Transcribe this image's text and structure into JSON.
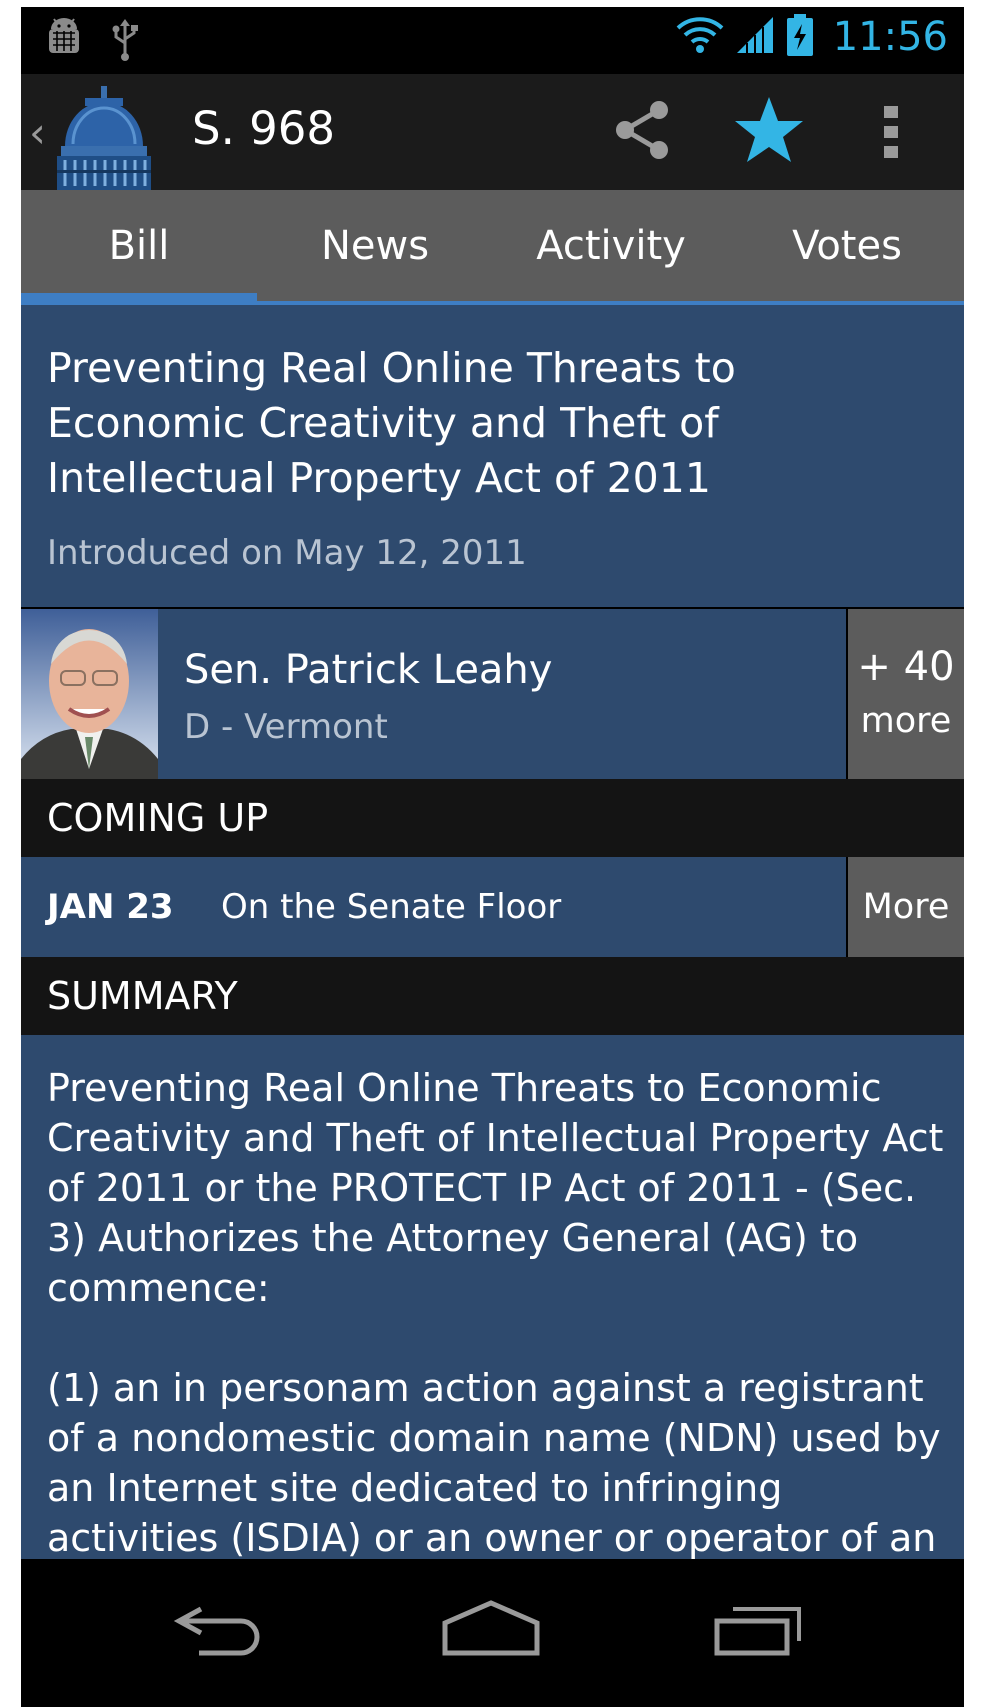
{
  "status_bar": {
    "time": "11:56",
    "icons": [
      "android-debug-icon",
      "usb-icon",
      "wifi-icon",
      "signal-icon",
      "battery-charging-icon"
    ]
  },
  "action_bar": {
    "title": "S. 968",
    "actions": [
      "share-icon",
      "star-icon",
      "overflow-menu-icon"
    ],
    "star_color": "#33b5e5"
  },
  "tabs": [
    {
      "label": "Bill",
      "active": true
    },
    {
      "label": "News",
      "active": false
    },
    {
      "label": "Activity",
      "active": false
    },
    {
      "label": "Votes",
      "active": false
    }
  ],
  "bill": {
    "title": "Preventing Real Online Threats to Economic Creativity and Theft of Intellectual Property Act of 2011",
    "introduced": "Introduced on May 12, 2011"
  },
  "sponsor": {
    "name": "Sen. Patrick Leahy",
    "party_state": "D - Vermont",
    "cosponsors_count": "+ 40",
    "cosponsors_more": "more"
  },
  "coming_up": {
    "header": "COMING UP",
    "date": "JAN 23",
    "location": "On the Senate Floor",
    "more_label": "More"
  },
  "summary": {
    "header": "SUMMARY",
    "paragraphs": [
      "Preventing Real Online Threats to Economic Creativity and Theft of Intellectual Property Act of 2011 or the PROTECT IP Act of 2011 - (Sec. 3) Authorizes the Attorney General (AG) to commence:",
      "(1) an in personam action against a registrant of a nondomestic domain name (NDN) used by an Internet site dedicated to infringing activities (ISDIA) or an owner or operator of an"
    ]
  },
  "nav_bar": {
    "buttons": [
      "back-icon",
      "home-icon",
      "recent-apps-icon"
    ]
  },
  "colors": {
    "accent": "#33b5e5",
    "tab_indicator": "#3e7ec4",
    "card_blue": "#2e4a6e",
    "gray_button": "#5c5c5c"
  }
}
